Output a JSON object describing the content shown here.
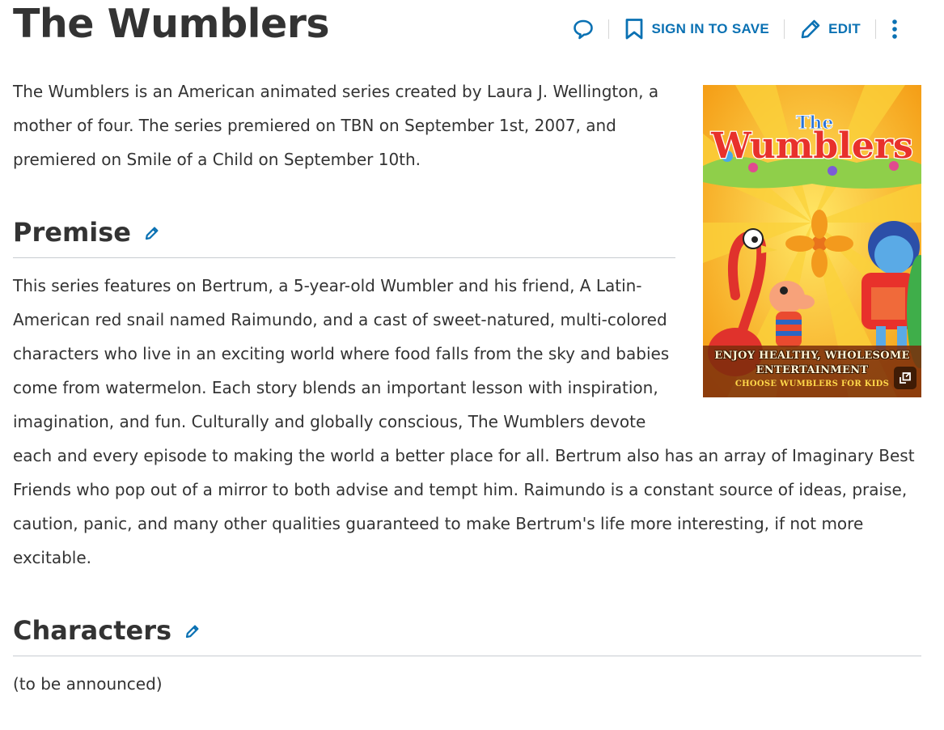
{
  "page": {
    "title": "The Wumblers"
  },
  "toolbar": {
    "comment_icon": "speech-bubble-icon",
    "save_icon": "bookmark-icon",
    "save_label": "SIGN IN TO SAVE",
    "edit_icon": "pencil-icon",
    "edit_label": "EDIT",
    "more_icon": "kebab-menu-icon",
    "accent_color": "#0a71b3"
  },
  "intro": {
    "text": "The Wumblers is an American animated series created by Laura J. Wellington, a mother of four. The series premiered on TBN on September 1st, 2007, and premiered on Smile of a Child on September 10th."
  },
  "sections": {
    "premise": {
      "heading": "Premise",
      "text": "This series features on Bertrum, a 5-year-old Wumbler and his friend, A Latin-American red snail named Raimundo, and a cast of sweet-natured, multi-colored characters who live in an exciting world where food falls from the sky and babies come from watermelon. Each story blends an important lesson with inspiration, imagination, and fun. Culturally and globally conscious, The Wumblers devote each and every episode to making the world a better place for all. Bertrum also has an array of Imaginary Best Friends who pop out of a mirror to both advise and tempt him. Raimundo is a constant source of ideas, praise, caution, panic, and many other qualities guaranteed to make Bertrum's life more interesting, if not more excitable."
    },
    "characters": {
      "heading": "Characters",
      "text": "(to be announced)"
    }
  },
  "poster": {
    "logo_text": "Wumblers",
    "tagline_line1": "ENJOY HEALTHY, WHOLESOME",
    "tagline_line2": "ENTERTAINMENT",
    "tagline_line3": "CHOOSE WUMBLERS FOR KIDS",
    "expand_icon": "expand-image-icon"
  }
}
